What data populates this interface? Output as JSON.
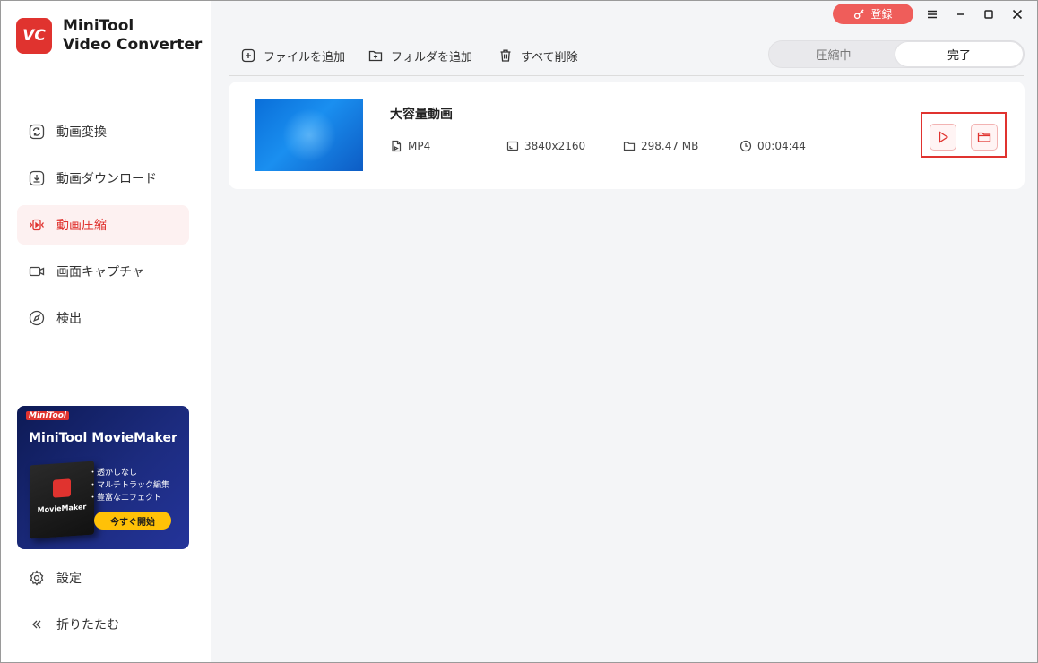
{
  "app": {
    "logo_text": "VC",
    "title_line1": "MiniTool",
    "title_line2": "Video Converter"
  },
  "titlebar": {
    "register_label": "登録",
    "menu_icon": "hamburger-icon",
    "minimize_icon": "minimize-icon",
    "maximize_icon": "maximize-icon",
    "close_icon": "close-icon"
  },
  "sidebar": {
    "items": [
      {
        "label": "動画変換",
        "icon": "convert-icon",
        "active": false
      },
      {
        "label": "動画ダウンロード",
        "icon": "download-icon",
        "active": false
      },
      {
        "label": "動画圧縮",
        "icon": "compress-icon",
        "active": true
      },
      {
        "label": "画面キャプチャ",
        "icon": "camera-icon",
        "active": false
      },
      {
        "label": "検出",
        "icon": "compass-icon",
        "active": false
      }
    ],
    "settings_label": "設定",
    "collapse_label": "折りたたむ"
  },
  "promo": {
    "brand": "MiniTool",
    "title": "MiniTool MovieMaker",
    "box_name": "MovieMaker",
    "features": [
      "・透かしなし",
      "・マルチトラック編集",
      "・豊富なエフェクト"
    ],
    "button_label": "今すぐ開始"
  },
  "toolbar": {
    "add_file_label": "ファイルを追加",
    "add_folder_label": "フォルダを追加",
    "delete_all_label": "すべて削除"
  },
  "tabs": {
    "compressing_label": "圧縮中",
    "completed_label": "完了",
    "active": "completed"
  },
  "file": {
    "name": "大容量動画",
    "format": "MP4",
    "resolution": "3840x2160",
    "size": "298.47 MB",
    "duration": "00:04:44"
  },
  "colors": {
    "accent": "#e0332f",
    "register_bg": "#ef5d5a",
    "active_nav_bg": "#fdf1f1",
    "promo_button": "#ffc107"
  }
}
